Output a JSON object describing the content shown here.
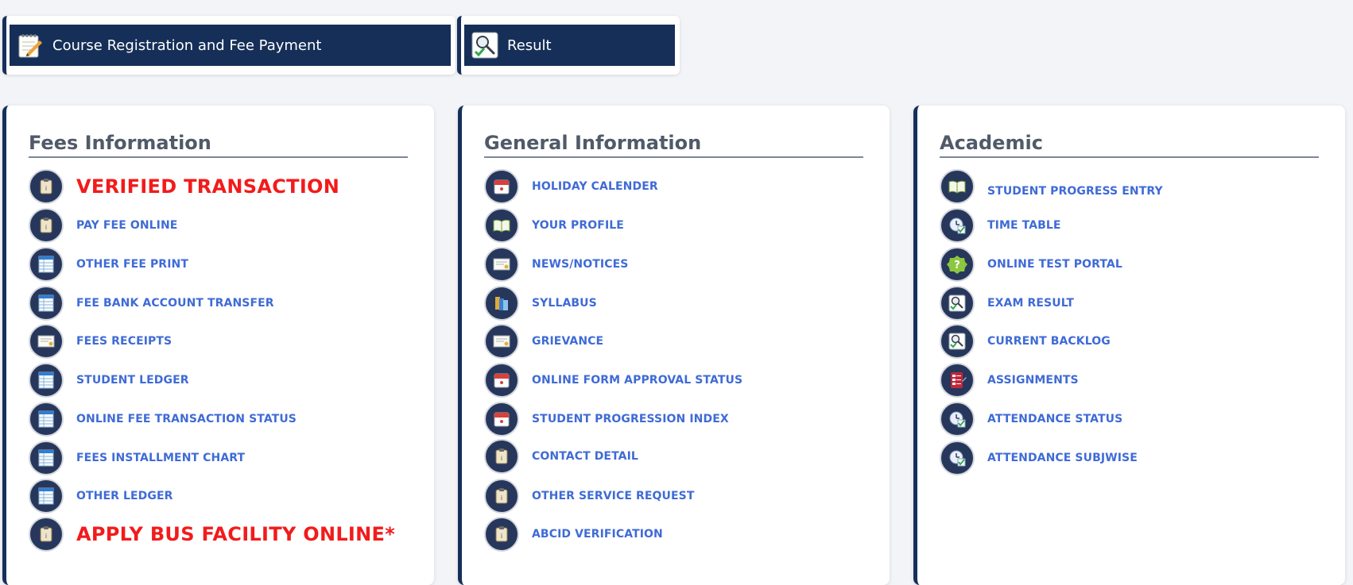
{
  "quick_links": [
    {
      "label": "Course Registration and Fee Payment",
      "icon": "notepad-pencil-icon"
    },
    {
      "label": "Result",
      "icon": "magnifier-check-icon"
    }
  ],
  "panels": [
    {
      "title": "Fees Information",
      "items": [
        {
          "label": "VERIFIED TRANSACTION",
          "icon": "clipboard-icon",
          "highlight": true
        },
        {
          "label": "PAY FEE ONLINE",
          "icon": "clipboard-icon"
        },
        {
          "label": "OTHER FEE PRINT",
          "icon": "table-sheet-icon"
        },
        {
          "label": "FEE BANK ACCOUNT TRANSFER",
          "icon": "table-sheet-icon"
        },
        {
          "label": "FEES RECEIPTS",
          "icon": "certificate-icon"
        },
        {
          "label": "STUDENT LEDGER",
          "icon": "table-sheet-icon"
        },
        {
          "label": "ONLINE FEE TRANSACTION STATUS",
          "icon": "table-sheet-icon"
        },
        {
          "label": "FEES INSTALLMENT CHART",
          "icon": "table-sheet-icon"
        },
        {
          "label": "OTHER LEDGER",
          "icon": "table-sheet-icon"
        },
        {
          "label": "APPLY BUS FACILITY ONLINE*",
          "icon": "clipboard-icon",
          "highlight": true
        }
      ]
    },
    {
      "title": "General Information",
      "items": [
        {
          "label": "HOLIDAY CALENDER",
          "icon": "calendar-icon"
        },
        {
          "label": "YOUR PROFILE",
          "icon": "open-book-icon"
        },
        {
          "label": "NEWS/NOTICES",
          "icon": "certificate-icon"
        },
        {
          "label": "SYLLABUS",
          "icon": "books-icon"
        },
        {
          "label": "GRIEVANCE",
          "icon": "certificate-icon"
        },
        {
          "label": "ONLINE FORM APPROVAL STATUS",
          "icon": "calendar-icon"
        },
        {
          "label": "STUDENT PROGRESSION INDEX",
          "icon": "calendar-icon"
        },
        {
          "label": "CONTACT DETAIL",
          "icon": "clipboard-icon"
        },
        {
          "label": "OTHER SERVICE REQUEST",
          "icon": "clipboard-icon"
        },
        {
          "label": "ABCID VERIFICATION",
          "icon": "clipboard-icon"
        }
      ]
    },
    {
      "title": "Academic",
      "items": [
        {
          "label": "STUDENT PROGRESS ENTRY",
          "icon": "open-book-icon"
        },
        {
          "label": "TIME TABLE",
          "icon": "clock-check-icon"
        },
        {
          "label": "ONLINE TEST PORTAL",
          "icon": "question-badge-icon"
        },
        {
          "label": "EXAM RESULT",
          "icon": "magnifier-check-icon"
        },
        {
          "label": "CURRENT BACKLOG",
          "icon": "magnifier-check-icon"
        },
        {
          "label": "ASSIGNMENTS",
          "icon": "checklist-icon"
        },
        {
          "label": "ATTENDANCE STATUS",
          "icon": "clock-check-icon"
        },
        {
          "label": "ATTENDANCE SUBJWISE",
          "icon": "clock-check-icon"
        }
      ]
    }
  ],
  "colors": {
    "navy": "#162f58",
    "link": "#3f6bd6",
    "highlight": "#f21b1b",
    "heading": "#505a68"
  }
}
